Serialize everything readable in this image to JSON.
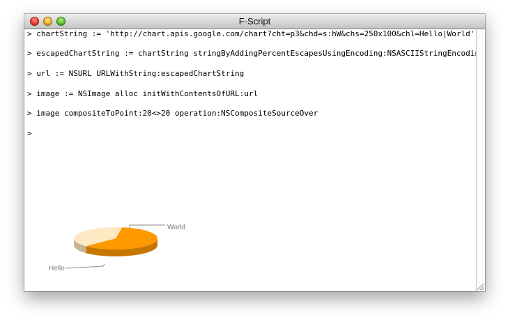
{
  "window": {
    "title": "F-Script"
  },
  "console": {
    "lines": [
      "> chartString := 'http://chart.apis.google.com/chart?cht=p3&chd=s:hW&chs=250x100&chl=Hello|World'",
      "> escapedChartString := chartString stringByAddingPercentEscapesUsingEncoding:NSASCIIStringEncoding",
      "> url := NSURL URLWithString:escapedChartString",
      "> image := NSImage alloc initWithContentsOfURL:url",
      "> image compositeToPoint:20<>20 operation:NSCompositeSourceOver",
      ">"
    ]
  },
  "chart_data": {
    "type": "pie",
    "categories": [
      "Hello",
      "World"
    ],
    "values": [
      33,
      22
    ],
    "colors": [
      "#FF9900",
      "#FFE8C4"
    ]
  },
  "icons": {
    "close": "close-button",
    "minimize": "minimize-button",
    "zoom": "zoom-button",
    "resize": "resize-grip-icon"
  }
}
